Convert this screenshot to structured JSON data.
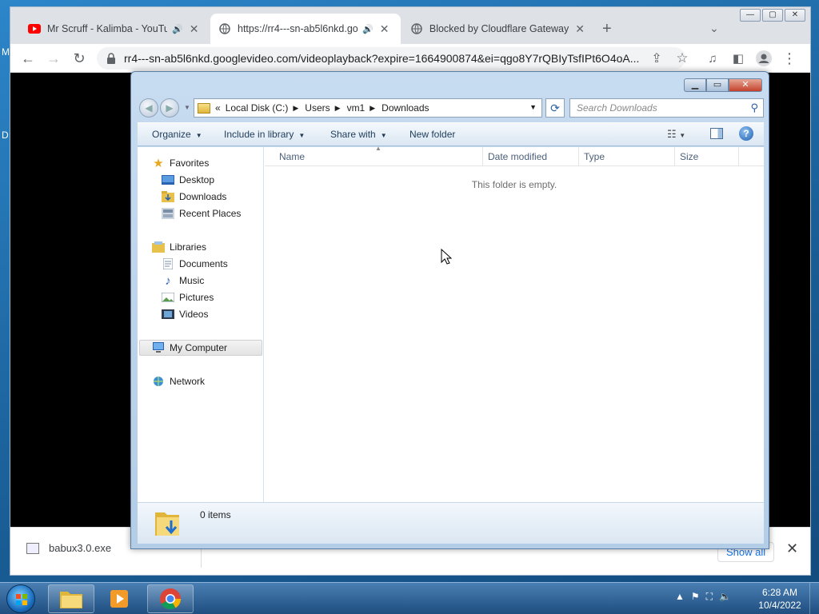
{
  "desktop": {
    "side_letters": [
      "M",
      "D"
    ]
  },
  "browser": {
    "tabs": [
      {
        "title": "Mr Scruff - Kalimba - YouTub",
        "active": false,
        "audio": true
      },
      {
        "title": "https://rr4---sn-ab5l6nkd.go",
        "active": true,
        "audio": true
      },
      {
        "title": "Blocked by Cloudflare Gateway",
        "active": false,
        "audio": false
      }
    ],
    "new_tab": "+",
    "url": "rr4---sn-ab5l6nkd.googlevideo.com/videoplayback?expire=1664900874&ei=qgo8Y7rQBIyTsfIPt6O4oA...",
    "window_controls": {
      "minimize": "—",
      "maximize": "▢",
      "close": "✕"
    }
  },
  "downloads_bar": {
    "file_name": "babux3.0.exe",
    "show_all": "Show all",
    "close": "✕"
  },
  "explorer": {
    "breadcrumb": [
      "«",
      "Local Disk (C:)",
      "Users",
      "vm1",
      "Downloads"
    ],
    "search_placeholder": "Search Downloads",
    "commands": [
      "Organize",
      "Include in library",
      "Share with",
      "New folder"
    ],
    "nav": {
      "favorites": {
        "label": "Favorites",
        "items": [
          "Desktop",
          "Downloads",
          "Recent Places"
        ]
      },
      "libraries": {
        "label": "Libraries",
        "items": [
          "Documents",
          "Music",
          "Pictures",
          "Videos"
        ]
      },
      "computer": "My Computer",
      "network": "Network"
    },
    "columns": [
      "Name",
      "Date modified",
      "Type",
      "Size"
    ],
    "empty_message": "This folder is empty.",
    "status_items": "0 items"
  },
  "taskbar": {
    "time": "6:28 AM",
    "date": "10/4/2022",
    "apps": [
      "windows-explorer",
      "media-player",
      "chrome"
    ]
  }
}
